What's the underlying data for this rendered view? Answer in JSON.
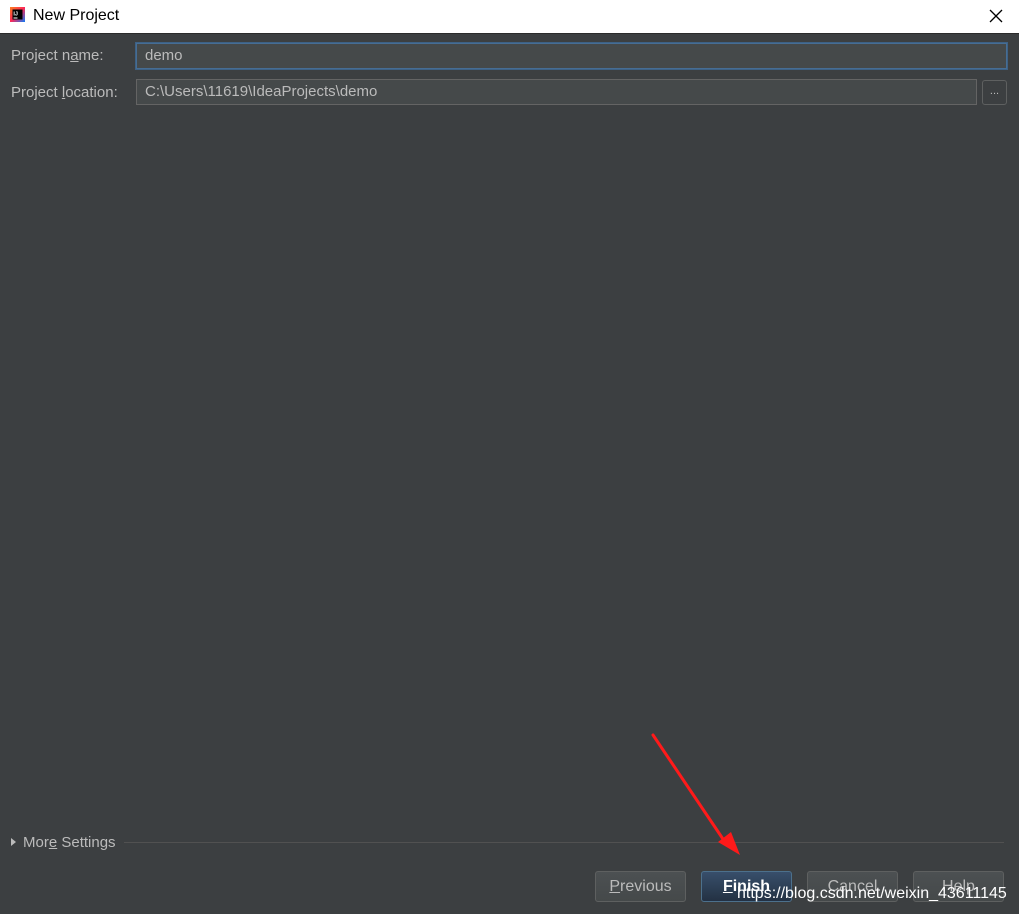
{
  "window": {
    "title": "New Project",
    "app_icon": "intellij-idea-icon",
    "close_icon": "close-icon"
  },
  "form": {
    "project_name": {
      "label_pre": "Project n",
      "label_mnemonic": "a",
      "label_post": "me:",
      "value": "demo"
    },
    "project_location": {
      "label_pre": "Project ",
      "label_mnemonic": "l",
      "label_post": "ocation:",
      "value": "C:\\Users\\11619\\IdeaProjects\\demo",
      "browse_label": "..."
    }
  },
  "more_settings": {
    "label_pre": "Mor",
    "label_mnemonic": "e",
    "label_post": " Settings"
  },
  "buttons": {
    "previous": {
      "mnemonic": "P",
      "rest": "revious"
    },
    "finish": {
      "mnemonic": "F",
      "rest": "inish"
    },
    "cancel": "Cancel",
    "help": "Help"
  },
  "watermark": "https://blog.csdn.net/weixin_43611145",
  "colors": {
    "background": "#3c3f41",
    "text": "#bbbbbb",
    "annotation_arrow": "#ff1a1a",
    "focus_border": "#466d94"
  }
}
